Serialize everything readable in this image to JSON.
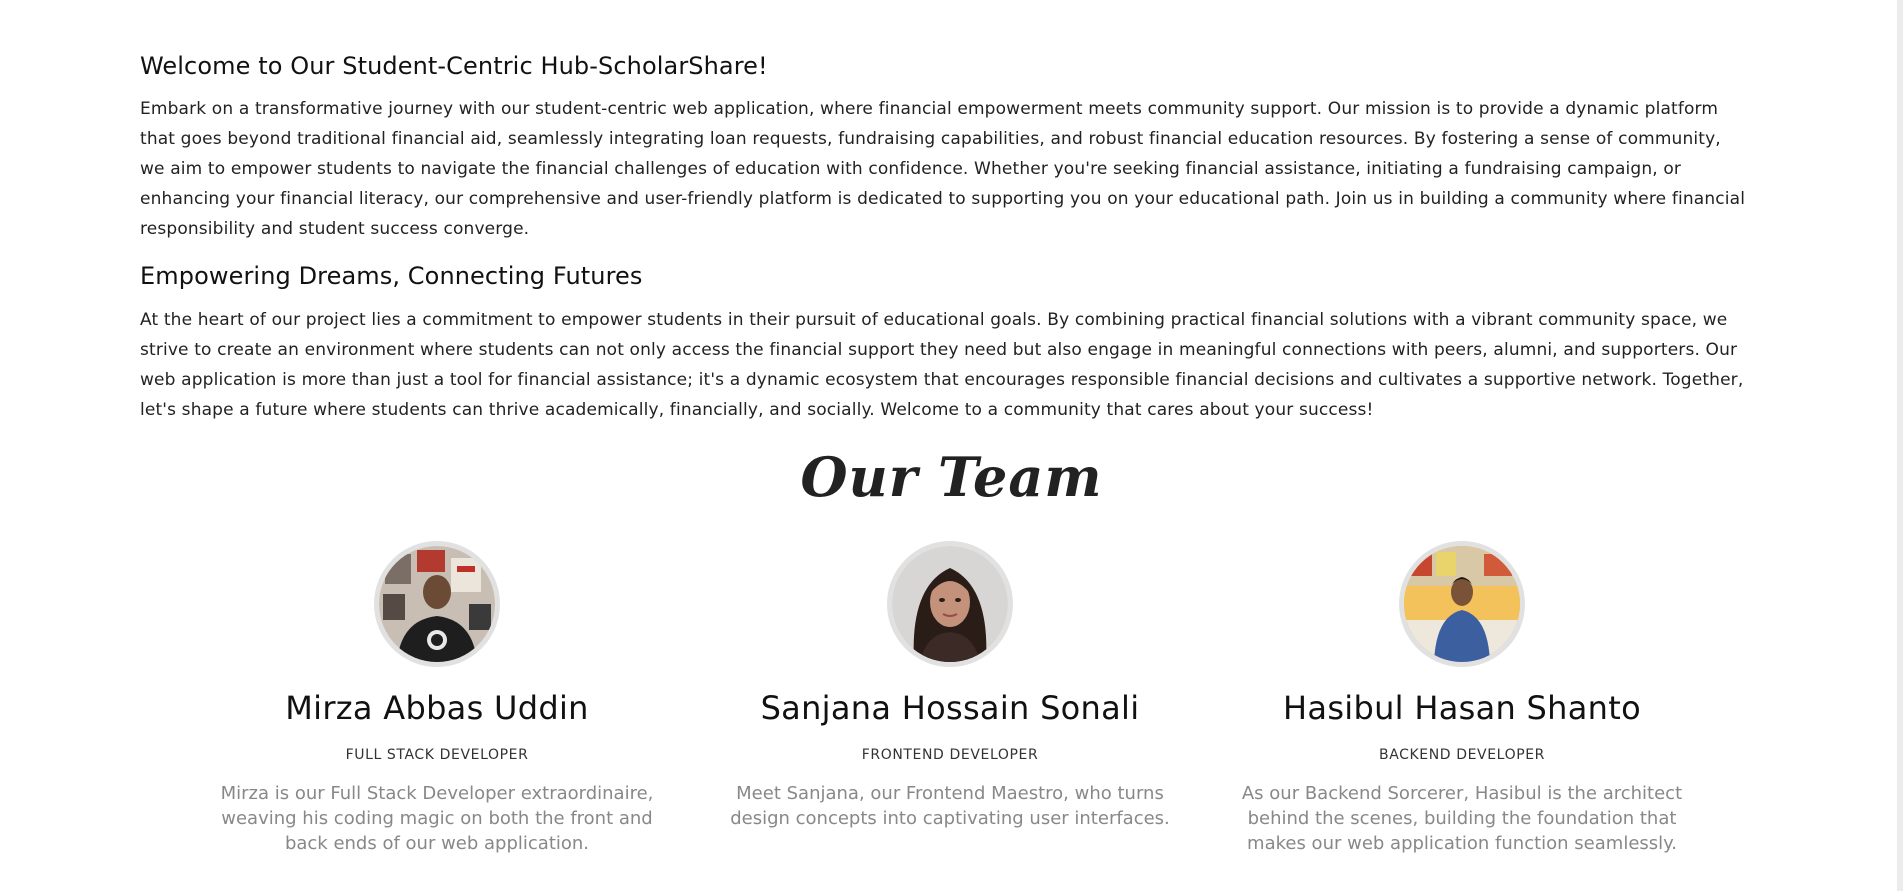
{
  "about": {
    "welcome_title": "Welcome to Our Student-Centric Hub-ScholarShare!",
    "welcome_body": "Embark on a transformative journey with our student-centric web application, where financial empowerment meets community support. Our mission is to provide a dynamic platform that goes beyond traditional financial aid, seamlessly integrating loan requests, fundraising capabilities, and robust financial education resources. By fostering a sense of community, we aim to empower students to navigate the financial challenges of education with confidence. Whether you're seeking financial assistance, initiating a fundraising campaign, or enhancing your financial literacy, our comprehensive and user-friendly platform is dedicated to supporting you on your educational path. Join us in building a community where financial responsibility and student success converge.",
    "mission_title": "Empowering Dreams, Connecting Futures",
    "mission_body": "At the heart of our project lies a commitment to empower students in their pursuit of educational goals. By combining practical financial solutions with a vibrant community space, we strive to create an environment where students can not only access the financial support they need but also engage in meaningful connections with peers, alumni, and supporters. Our web application is more than just a tool for financial assistance; it's a dynamic ecosystem that encourages responsible financial decisions and cultivates a supportive network. Together, let's shape a future where students can thrive academically, financially, and socially. Welcome to a community that cares about your success!"
  },
  "team": {
    "heading": "Our Team",
    "members": [
      {
        "name": "Mirza Abbas Uddin",
        "role": "FULL STACK DEVELOPER",
        "description": "Mirza is our Full Stack Developer extraordinaire, weaving his coding magic on both the front and back ends of our web application."
      },
      {
        "name": "Sanjana Hossain Sonali",
        "role": "FRONTEND DEVELOPER",
        "description": "Meet Sanjana, our Frontend Maestro, who turns design concepts into captivating user interfaces."
      },
      {
        "name": "Hasibul Hasan Shanto",
        "role": "BACKEND DEVELOPER",
        "description": "As our Backend Sorcerer, Hasibul is the architect behind the scenes, building the foundation that makes our web application function seamlessly."
      }
    ]
  },
  "colors": {
    "background": "#ffffff",
    "heading_text": "#111111",
    "body_text": "#222222",
    "description_text": "#888888",
    "avatar_border": "#e1e1e1"
  }
}
